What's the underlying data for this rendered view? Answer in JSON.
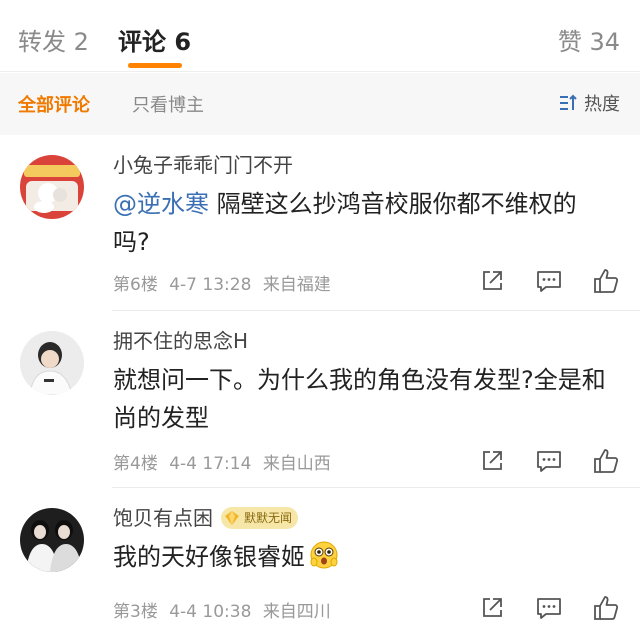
{
  "tabs": {
    "retweet": "转发 2",
    "comments": "评论 6",
    "likes": "赞 34"
  },
  "filters": {
    "all": "全部评论",
    "author_only": "只看博主",
    "sort": "热度"
  },
  "colors": {
    "accent": "#ff8200",
    "mention": "#3a6fb4"
  },
  "comments": [
    {
      "username": "小兔子乖乖门门不开",
      "mention": "@逆水寒",
      "text": " 隔壁这么抄鸿音校服你都不维权的吗?",
      "floor": "第6楼",
      "date": "4-7 13:28",
      "location": "来自福建"
    },
    {
      "username": "拥不住的思念H",
      "text": "就想问一下。为什么我的角色没有发型?全是和尚的发型",
      "floor": "第4楼",
      "date": "4-4 17:14",
      "location": "来自山西"
    },
    {
      "username": "饱贝有点困",
      "badge": "默默无闻",
      "text": "我的天好像银睿姬",
      "emoji": "surprised-face-emoji",
      "floor": "第3楼",
      "date": "4-4 10:38",
      "location": "来自四川"
    }
  ]
}
